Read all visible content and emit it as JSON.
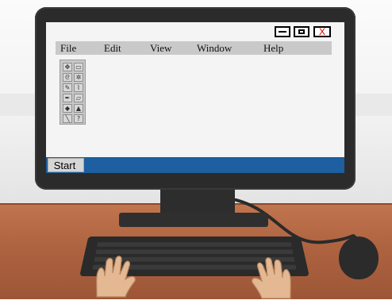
{
  "window": {
    "buttons": [
      {
        "name": "minimize",
        "icon": "minimize-icon"
      },
      {
        "name": "maximize",
        "icon": "maximize-icon"
      },
      {
        "name": "close",
        "label": "X",
        "color": "#d60000"
      }
    ]
  },
  "menubar": {
    "items": [
      "File",
      "Edit",
      "View",
      "Window",
      "Help"
    ]
  },
  "toolbox": {
    "tools": [
      "select-icon",
      "marquee-icon",
      "lasso-icon",
      "magic-wand-icon",
      "pencil-icon",
      "brush-icon",
      "pen-icon",
      "eraser-icon",
      "fill-icon",
      "text-icon",
      "line-icon",
      "eyedropper-icon"
    ]
  },
  "taskbar": {
    "start_label": "Start",
    "color": "#1d5fa0"
  }
}
